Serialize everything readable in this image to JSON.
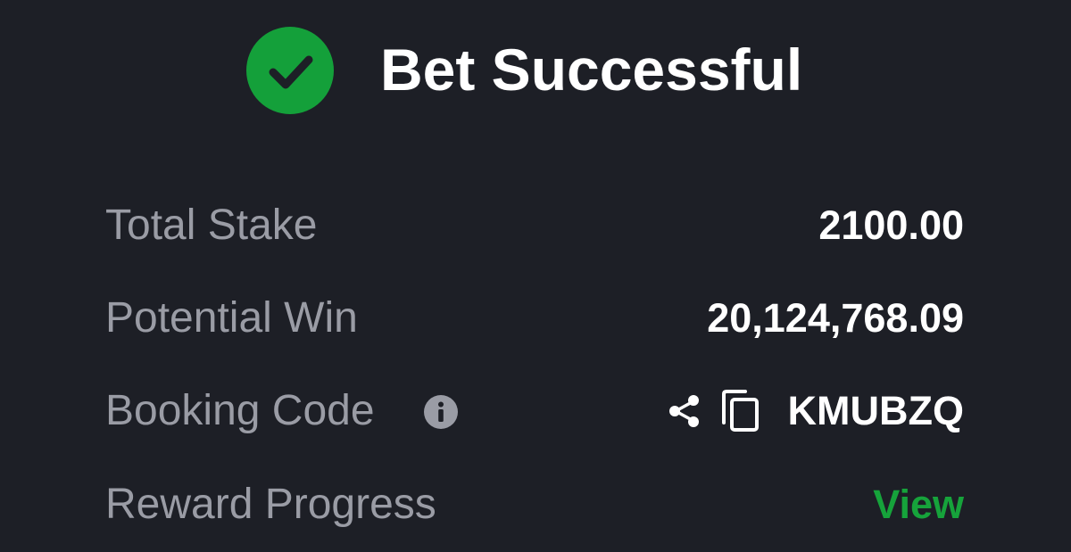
{
  "header": {
    "title": "Bet Successful",
    "icon": "check-circle-icon",
    "icon_color": "#14a03a"
  },
  "rows": {
    "total_stake": {
      "label": "Total Stake",
      "value": "2100.00"
    },
    "potential_win": {
      "label": "Potential Win",
      "value": "20,124,768.09"
    },
    "booking_code": {
      "label": "Booking Code",
      "info_icon": "info-icon",
      "share_icon": "share-icon",
      "copy_icon": "copy-icon",
      "value": "KMUBZQ"
    },
    "reward_progress": {
      "label": "Reward Progress",
      "link": "View",
      "link_color": "#16a33b"
    }
  },
  "colors": {
    "background": "#1d1f26",
    "label": "#9a9ca5",
    "value": "#ffffff"
  }
}
